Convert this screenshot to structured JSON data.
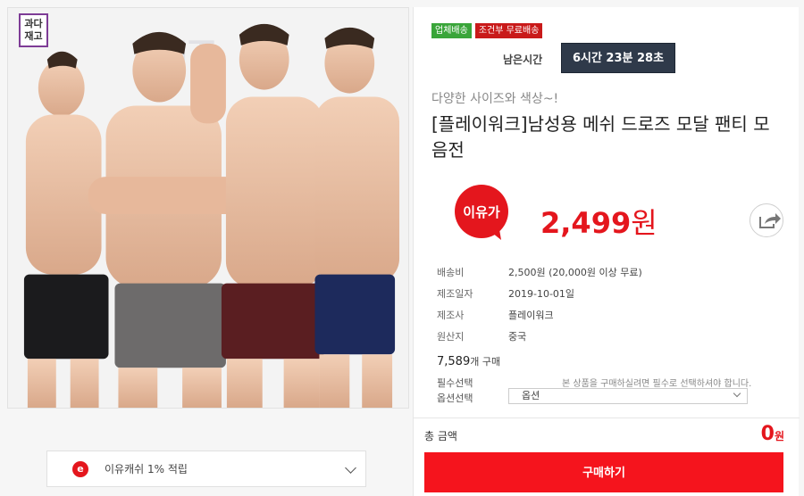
{
  "image": {
    "overstock_badge": "과다\n재고",
    "overstock_line1": "과다",
    "overstock_line2": "재고"
  },
  "cashback": {
    "badge": "e",
    "text": "이유캐쉬 1% 적립"
  },
  "tags": [
    "업체배송",
    "조건부 무료배송"
  ],
  "timer": {
    "label": "남은시간",
    "value": "6시간 23분 28초"
  },
  "product": {
    "subtitle": "다양한 사이즈와 색상~!",
    "title": "[플레이워크]남성용 메쉬 드로즈 모달 팬티 모음전",
    "price_logo": "이유가",
    "price": "2,499",
    "price_unit": "원"
  },
  "specs": [
    {
      "key": "배송비",
      "value": "2,500원 (20,000원 이상 무료)"
    },
    {
      "key": "제조일자",
      "value": "2019-10-01일"
    },
    {
      "key": "제조사",
      "value": "플레이워크"
    },
    {
      "key": "원산지",
      "value": "중국"
    }
  ],
  "purchase_count": {
    "value": "7,589",
    "unit": "개 구매"
  },
  "options": {
    "required_label": "필수선택",
    "required_note": "본 상품을 구매하실려면 필수로 선택하셔야 합니다.",
    "option_label": "옵션선택",
    "option_value": "옵션"
  },
  "total": {
    "label": "총 금액",
    "value": "0",
    "unit": "원"
  },
  "buy_button": "구매하기",
  "colors": {
    "accent": "#e4161d",
    "timer_bg": "#2f3a4a",
    "tag_green": "#3aa53a",
    "tag_red": "#c91a1a"
  }
}
